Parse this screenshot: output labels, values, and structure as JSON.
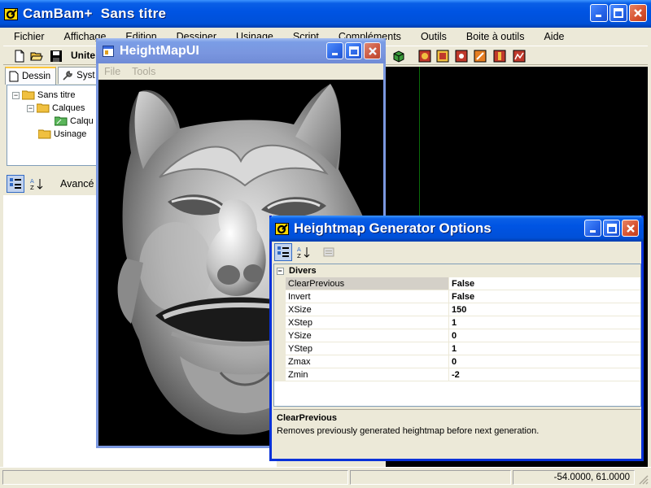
{
  "main_window": {
    "app_name": "CamBam+",
    "doc_title": "Sans titre",
    "menu": [
      "Fichier",
      "Affichage",
      "Edition",
      "Dessiner",
      "Usinage",
      "Script",
      "Compléments",
      "Outils",
      "Boite à outils",
      "Aide"
    ],
    "units_label": "Unite",
    "tabs": [
      {
        "label": "Dessin"
      },
      {
        "label": "Syst"
      }
    ],
    "tree": {
      "root": "Sans titre",
      "layers": "Calques",
      "layer_item": "Calqu",
      "machining": "Usinage"
    },
    "props_advanced_label": "Avancé",
    "status": {
      "cell1": "",
      "cell2": "",
      "coords": "-54.0000, 61.0000"
    }
  },
  "heightmap_window": {
    "title": "HeightMapUI",
    "menu": [
      "File",
      "Tools"
    ]
  },
  "options_dialog": {
    "title": "Heightmap Generator Options",
    "category": "Divers",
    "properties": [
      {
        "name": "ClearPrevious",
        "value": "False"
      },
      {
        "name": "Invert",
        "value": "False"
      },
      {
        "name": "XSize",
        "value": "150"
      },
      {
        "name": "XStep",
        "value": "1"
      },
      {
        "name": "YSize",
        "value": "0"
      },
      {
        "name": "YStep",
        "value": "1"
      },
      {
        "name": "Zmax",
        "value": "0"
      },
      {
        "name": "Zmin",
        "value": "-2"
      }
    ],
    "selected_property": "ClearPrevious",
    "help_title": "ClearPrevious",
    "help_text": "Removes previously generated heightmap before next generation."
  },
  "colors": {
    "xp_blue": "#0054e3",
    "xp_face": "#ece9d8",
    "close_red": "#d6512f"
  }
}
